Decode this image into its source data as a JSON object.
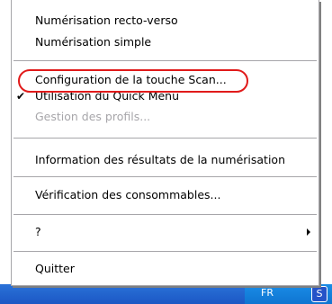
{
  "menu": {
    "items": [
      {
        "label": "Numérisation recto-verso",
        "enabled": true,
        "checked": false
      },
      {
        "label": "Numérisation simple",
        "enabled": true,
        "checked": false
      },
      {
        "label": "Configuration de la touche Scan...",
        "enabled": true,
        "checked": false
      },
      {
        "label": "Utilisation du Quick Menu",
        "enabled": true,
        "checked": true
      },
      {
        "label": "Gestion des profils...",
        "enabled": false,
        "checked": false
      },
      {
        "label": "Information des résultats de la numérisation",
        "enabled": true,
        "checked": false
      },
      {
        "label": "Vérification des consommables...",
        "enabled": true,
        "checked": false
      },
      {
        "label": "?",
        "enabled": true,
        "checked": false,
        "submenu": true
      },
      {
        "label": "Quitter",
        "enabled": true,
        "checked": false
      }
    ]
  },
  "check_mark": "✔",
  "taskbar": {
    "language": "FR",
    "tray_icon": "S"
  },
  "highlight_color": "#e11a1a"
}
